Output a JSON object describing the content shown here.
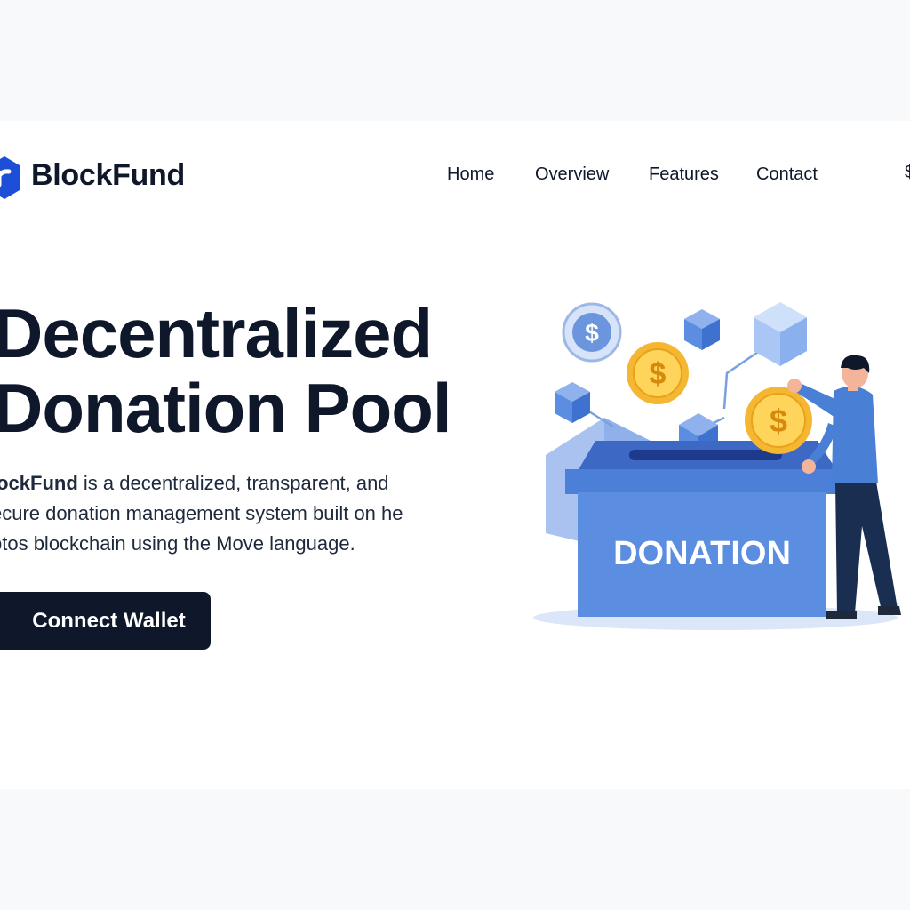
{
  "header": {
    "brand": "BlockFund",
    "nav": [
      "Home",
      "Overview",
      "Features",
      "Contact"
    ],
    "extra_glyph": "$"
  },
  "hero": {
    "title_line1": "Decentralized",
    "title_line2": "Donation Pool",
    "desc_strong": "lockFund",
    "desc_line1_rest": " is a decentralized, transparent, and",
    "desc_line2": "ecure donation management system built on he",
    "desc_line3": "ptos blockchain using the Move language.",
    "cta_label": "Connect Wallet"
  },
  "illustration": {
    "box_label": "DONATION",
    "coin_symbol": "$"
  },
  "colors": {
    "primary_dark": "#0f172a",
    "accent_blue": "#4a7fd6",
    "coin_gold": "#f5b731",
    "page_bg": "#f8f9fa"
  }
}
